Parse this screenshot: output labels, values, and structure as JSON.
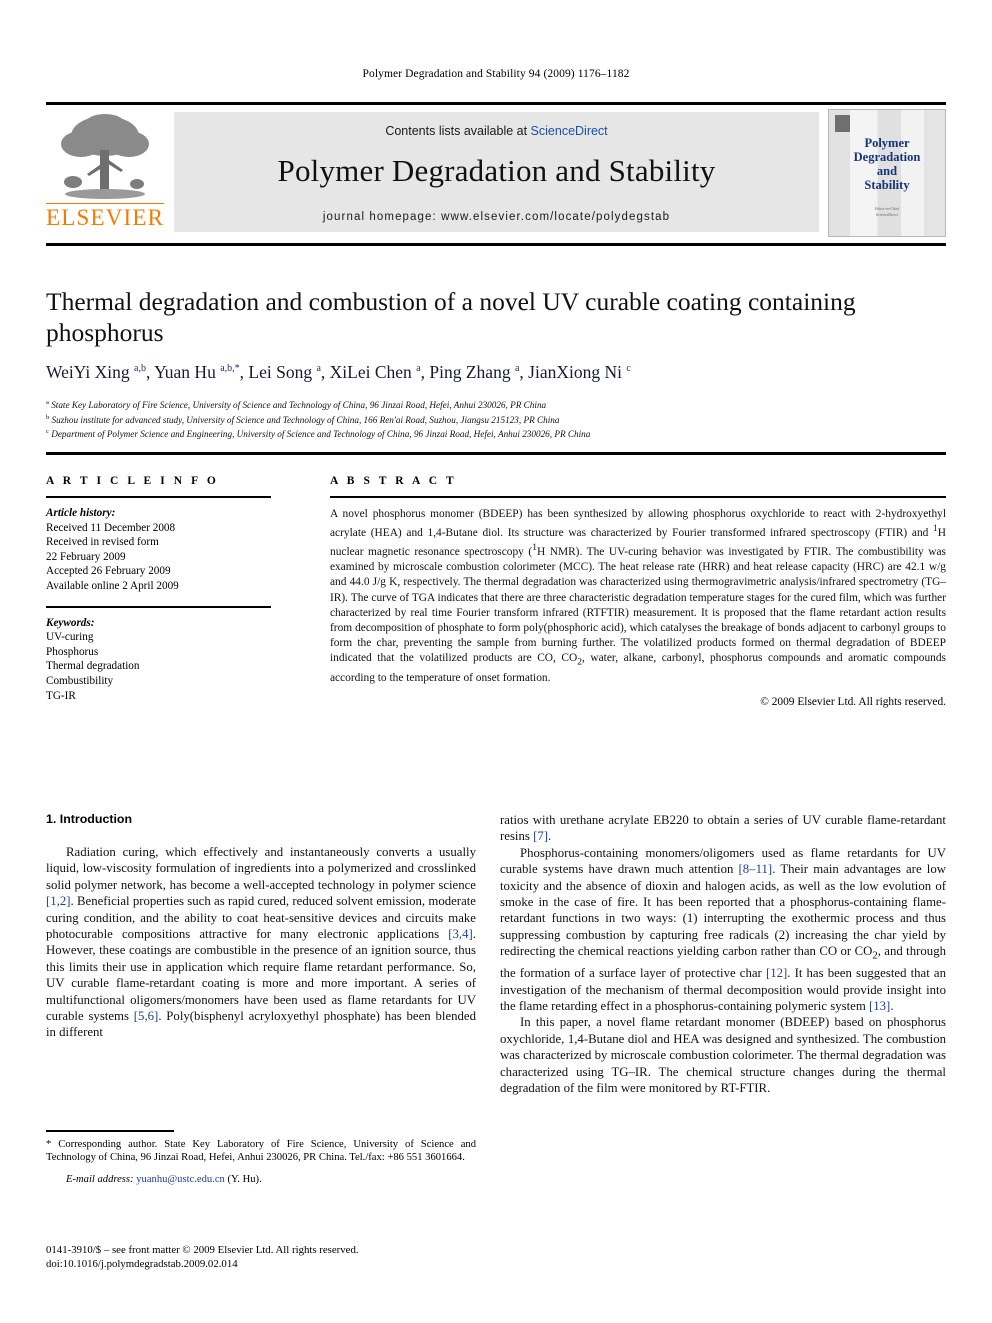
{
  "running_head": "Polymer Degradation and Stability 94 (2009) 1176–1182",
  "masthead": {
    "contents_prefix": "Contents lists available at ",
    "sciencedirect": "ScienceDirect",
    "journal_title": "Polymer Degradation and Stability",
    "homepage": "journal homepage: www.elsevier.com/locate/polydegstab",
    "publisher_logo_text": "ELSEVIER",
    "cover_title": "Polymer\nDegradation\nand\nStability",
    "cover_footer": "Editor-in-Chief\nScienceDirect"
  },
  "article": {
    "title": "Thermal degradation and combustion of a novel UV curable coating containing phosphorus",
    "authors_html": "WeiYi Xing <sup>a,b</sup>, Yuan Hu <sup>a,b,</sup><sup>*</sup>, Lei Song <sup>a</sup>, XiLei Chen <sup>a</sup>, Ping Zhang <sup>a</sup>, JianXiong Ni <sup>c</sup>",
    "affiliations": [
      "State Key Laboratory of Fire Science, University of Science and Technology of China, 96 Jinzai Road, Hefei, Anhui 230026, PR China",
      "Suzhou institute for advanced study, University of Science and Technology of China, 166 Ren'ai Road, Suzhou, Jiangsu 215123, PR China",
      "Department of Polymer Science and Engineering, University of Science and Technology of China, 96 Jinzai Road, Hefei, Anhui 230026, PR China"
    ],
    "affiliation_marks": [
      "a",
      "b",
      "c"
    ]
  },
  "article_info": {
    "heading": "A R T I C L E  I N F O",
    "history_label": "Article history:",
    "history": [
      "Received 11 December 2008",
      "Received in revised form",
      "22 February 2009",
      "Accepted 26 February 2009",
      "Available online 2 April 2009"
    ],
    "keywords_label": "Keywords:",
    "keywords": [
      "UV-curing",
      "Phosphorus",
      "Thermal degradation",
      "Combustibility",
      "TG-IR"
    ]
  },
  "abstract": {
    "heading": "A B S T R A C T",
    "text_html": "A novel phosphorus monomer (BDEEP) has been synthesized by allowing phosphorus oxychloride to react with 2-hydroxyethyl acrylate (HEA) and 1,4-Butane diol. Its structure was characterized by Fourier transformed infrared spectroscopy (FTIR) and <sup>1</sup>H nuclear magnetic resonance spectroscopy (<sup>1</sup>H NMR). The UV-curing behavior was investigated by FTIR. The combustibility was examined by microscale combustion colorimeter (MCC). The heat release rate (HRR) and heat release capacity (HRC) are 42.1 w/g and 44.0 J/g K, respectively. The thermal degradation was characterized using thermogravimetric analysis/infrared spectrometry (TG–IR). The curve of TGA indicates that there are three characteristic degradation temperature stages for the cured film, which was further characterized by real time Fourier transform infrared (RTFTIR) measurement. It is proposed that the flame retardant action results from decomposition of phosphate to form poly(phosphoric acid), which catalyses the breakage of bonds adjacent to carbonyl groups to form the char, preventing the sample from burning further. The volatilized products formed on thermal degradation of BDEEP indicated that the volatilized products are CO, CO<sub>2</sub>, water, alkane, carbonyl, phosphorus compounds and aromatic compounds according to the temperature of onset formation.",
    "copyright": "© 2009 Elsevier Ltd. All rights reserved."
  },
  "introduction": {
    "heading": "1. Introduction",
    "left_paragraphs_html": [
      "Radiation curing, which effectively and instantaneously converts a usually liquid, low-viscosity formulation of ingredients into a polymerized and crosslinked solid polymer network, has become a well-accepted technology in polymer science <span class=\"ref\">[1,2]</span>. Beneficial properties such as rapid cured, reduced solvent emission, moderate curing condition, and the ability to coat heat-sensitive devices and circuits make photocurable compositions attractive for many electronic applications <span class=\"ref\">[3,4]</span>. However, these coatings are combustible in the presence of an ignition source, thus this limits their use in application which require flame retardant performance. So, UV curable flame-retardant coating is more and more important. A series of multifunctional oligomers/monomers have been used as flame retardants for UV curable systems <span class=\"ref\">[5,6]</span>. Poly(bisphenyl acryloxyethyl phosphate) has been blended in different"
    ],
    "right_paragraphs_html": [
      "ratios with urethane acrylate EB220 to obtain a series of UV curable flame-retardant resins <span class=\"ref\">[7]</span>.",
      "Phosphorus-containing monomers/oligomers used as flame retardants for UV curable systems have drawn much attention <span class=\"ref\">[8–11]</span>. Their main advantages are low toxicity and the absence of dioxin and halogen acids, as well as the low evolution of smoke in the case of fire. It has been reported that a phosphorus-containing flame-retardant functions in two ways: (1) interrupting the exothermic process and thus suppressing combustion by capturing free radicals (2) increasing the char yield by redirecting the chemical reactions yielding carbon rather than CO or CO<sub>2</sub>, and through the formation of a surface layer of protective char <span class=\"ref\">[12]</span>. It has been suggested that an investigation of the mechanism of thermal decomposition would provide insight into the flame retarding effect in a phosphorus-containing polymeric system <span class=\"ref\">[13]</span>.",
      "In this paper, a novel flame retardant monomer (BDEEP) based on phosphorus oxychloride, 1,4-Butane diol and HEA was designed and synthesized. The combustion was characterized by microscale combustion colorimeter. The thermal degradation was characterized using TG–IR. The chemical structure changes during the thermal degradation of the film were monitored by RT-FTIR."
    ]
  },
  "footnote": {
    "corresponding_html": "* Corresponding author. State Key Laboratory of Fire Science, University of Science and Technology of China, 96 Jinzai Road, Hefei, Anhui 230026, PR China. Tel./fax: +86 551 3601664.",
    "email_label": "E-mail address:",
    "email": "yuanhu@ustc.edu.cn",
    "email_suffix": "(Y. Hu)."
  },
  "issn": {
    "line1": "0141-3910/$ – see front matter © 2009 Elsevier Ltd. All rights reserved.",
    "line2": "doi:10.1016/j.polymdegradstab.2009.02.014"
  },
  "colors": {
    "link": "#1f4fa3",
    "reference": "#1f3f8f",
    "elsevier_orange": "#f07d00",
    "band_gray": "#e6e6e6",
    "cover_blue": "#16347a"
  }
}
